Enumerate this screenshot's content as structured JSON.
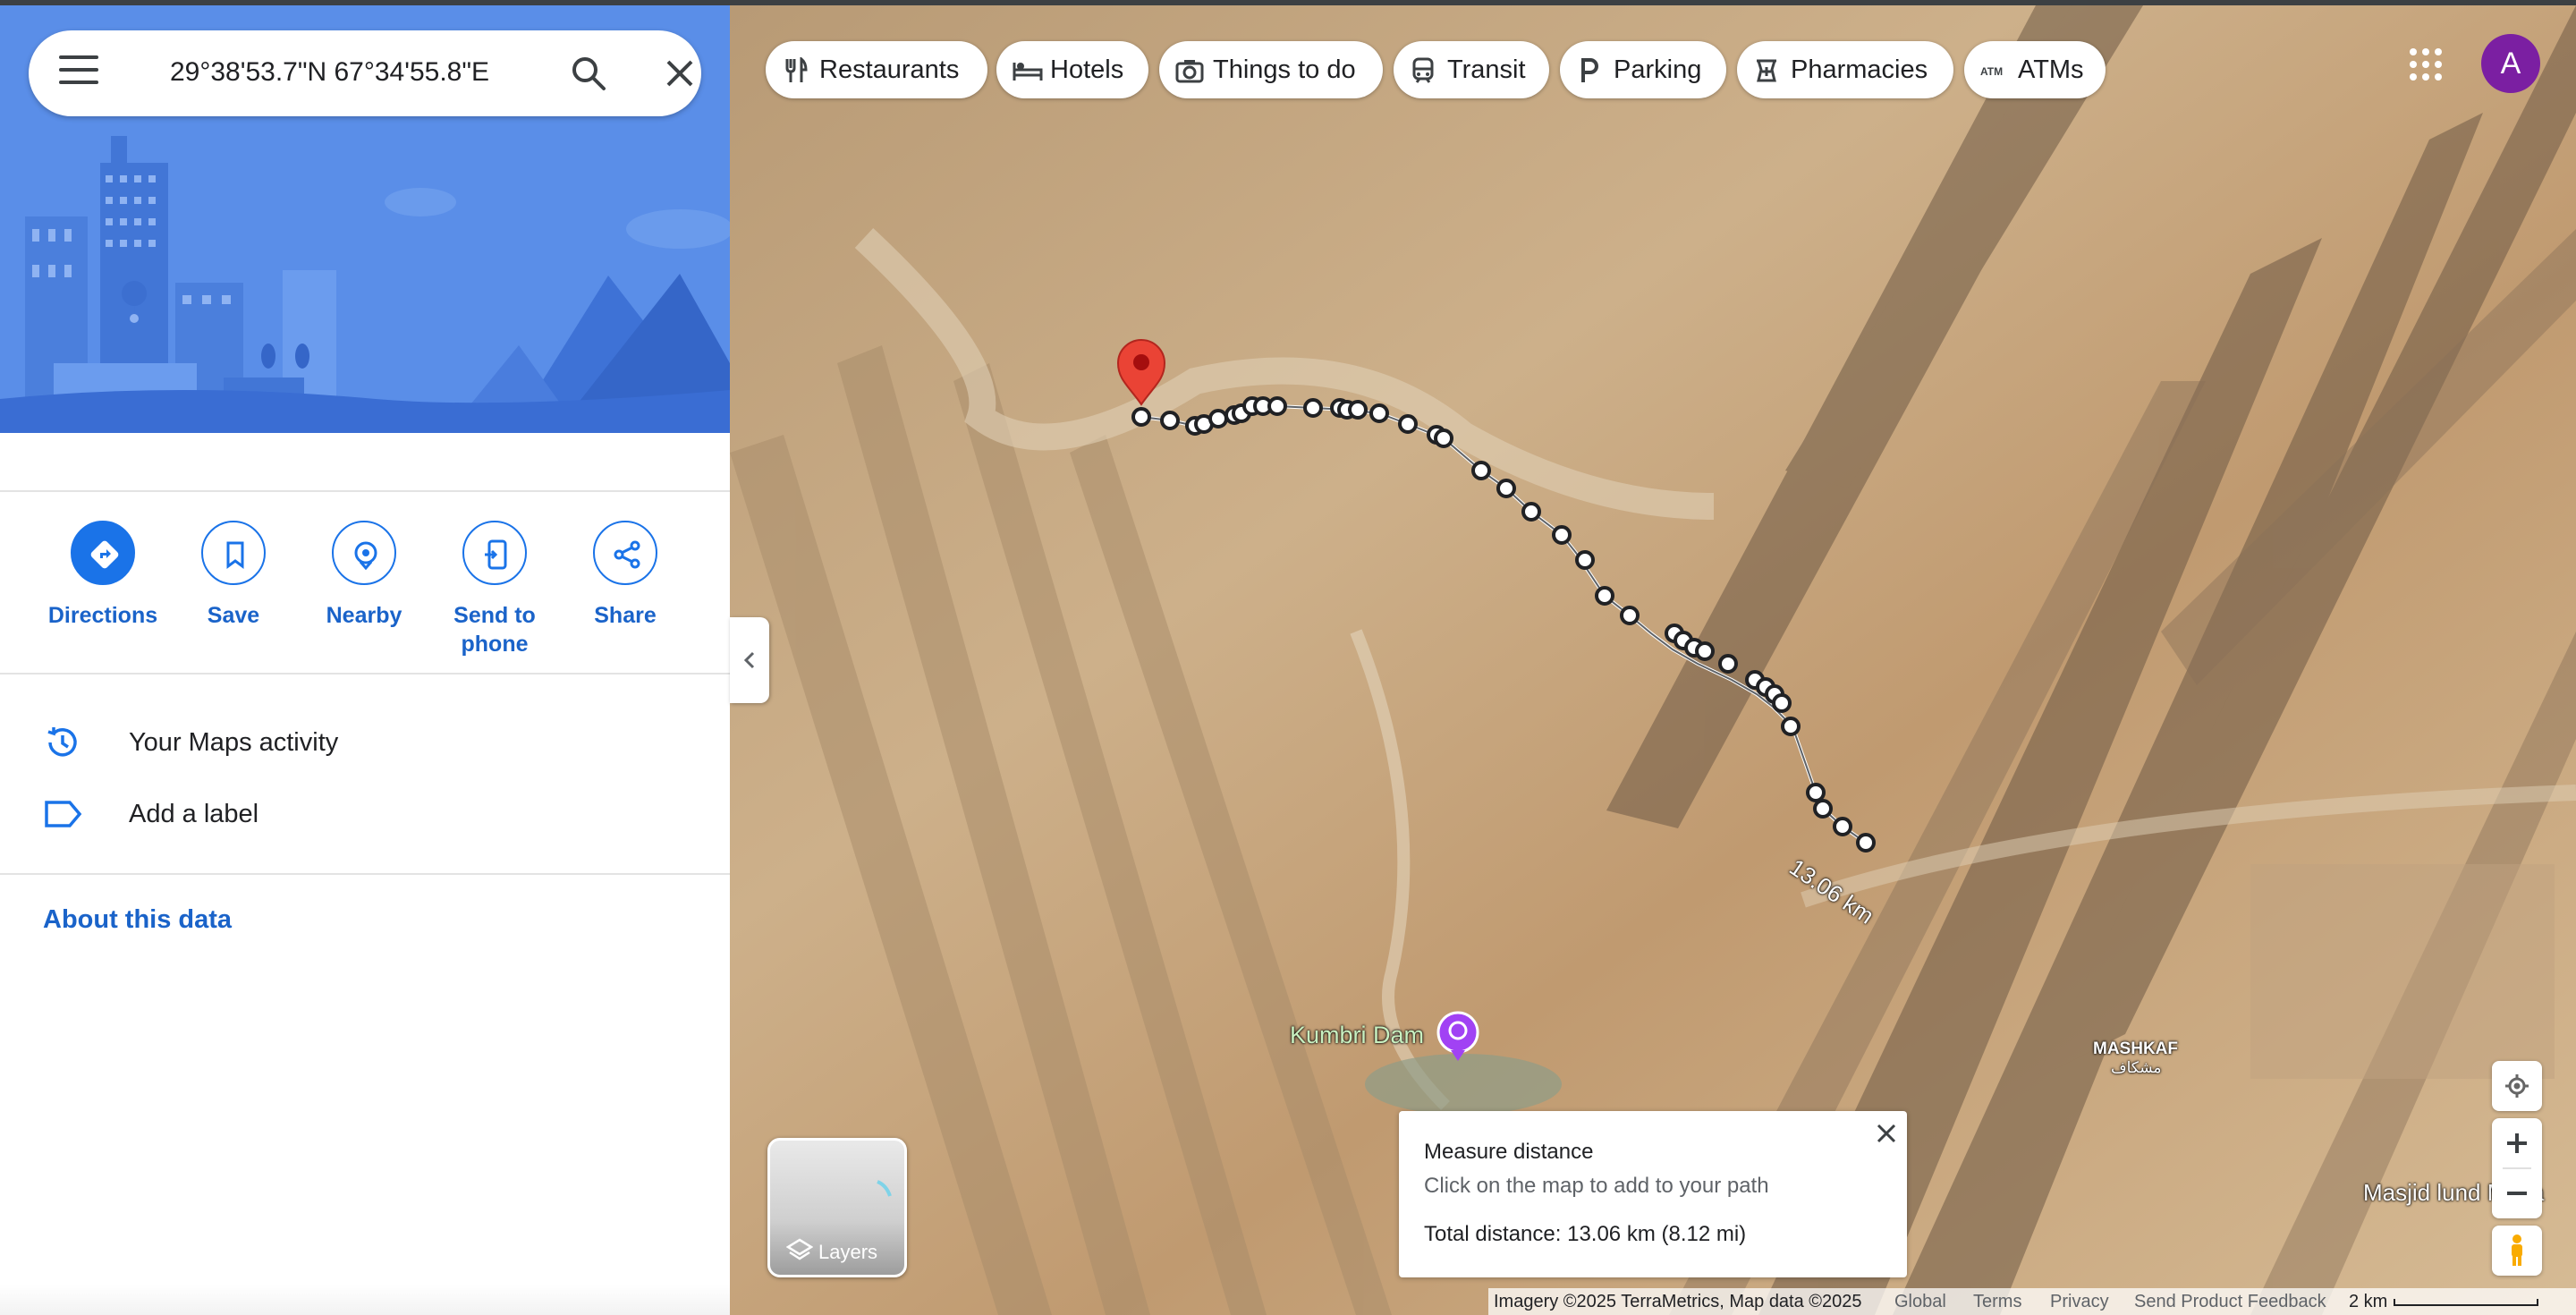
{
  "search": {
    "query": "29°38'53.7\"N 67°34'55.8\"E"
  },
  "actions": [
    {
      "label": "Directions"
    },
    {
      "label": "Save"
    },
    {
      "label": "Nearby"
    },
    {
      "label": "Send to phone"
    },
    {
      "label": "Share"
    }
  ],
  "menu": {
    "activity": "Your Maps activity",
    "label": "Add a label",
    "about": "About this data"
  },
  "chips": [
    {
      "label": "Restaurants",
      "icon": "fork-knife-icon"
    },
    {
      "label": "Hotels",
      "icon": "bed-icon"
    },
    {
      "label": "Things to do",
      "icon": "camera-icon"
    },
    {
      "label": "Transit",
      "icon": "train-icon"
    },
    {
      "label": "Parking",
      "icon": "parking-icon"
    },
    {
      "label": "Pharmacies",
      "icon": "pharmacy-icon"
    },
    {
      "label": "ATMs",
      "icon": "atm-icon"
    }
  ],
  "account": {
    "initial": "A"
  },
  "map": {
    "path_label": "13.06 km",
    "place_label": "Kumbri Dam",
    "town_label": "MASHKAF",
    "town_label_local": "مشكاف",
    "edge_label": "Masjid lund Mosa"
  },
  "layers": {
    "label": "Layers"
  },
  "measure": {
    "title": "Measure distance",
    "hint": "Click on the map to add to your path",
    "total": "Total distance: 13.06 km (8.12 mi)"
  },
  "footer": {
    "imagery": "Imagery ©2025 TerraMetrics, Map data ©2025",
    "global": "Global",
    "terms": "Terms",
    "privacy": "Privacy",
    "feedback": "Send Product Feedback",
    "scale": "2 km"
  },
  "colors": {
    "accent": "#1a73e8",
    "hero": "#5186e4",
    "pin": "#ea4335",
    "avatar": "#7b1fa2"
  }
}
